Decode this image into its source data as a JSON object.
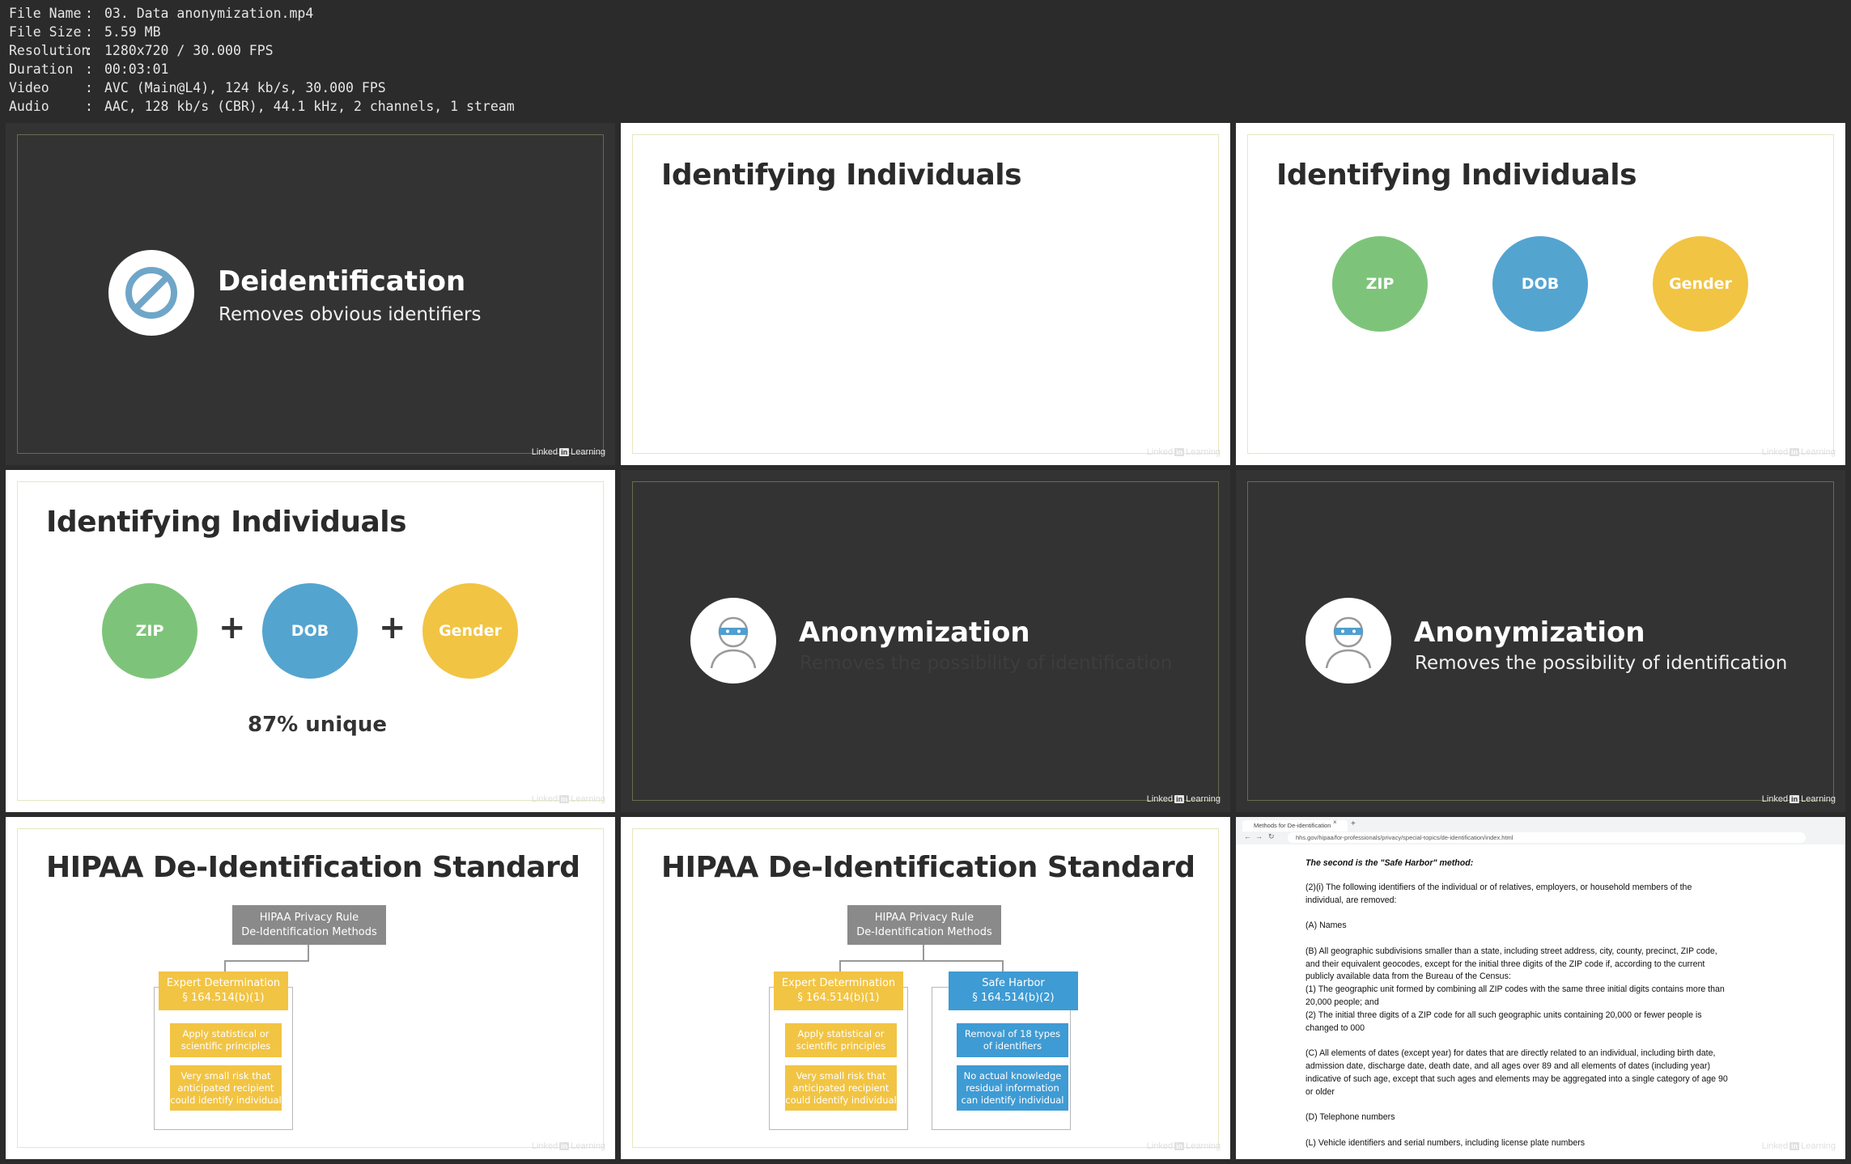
{
  "file_info": [
    {
      "key": "File Name",
      "value": "03. Data anonymization.mp4"
    },
    {
      "key": "File Size",
      "value": "5.59 MB"
    },
    {
      "key": "Resolution",
      "value": "1280x720 / 30.000 FPS"
    },
    {
      "key": "Duration",
      "value": "00:03:01"
    },
    {
      "key": "Video",
      "value": "AVC (Main@L4), 124 kb/s, 30.000 FPS"
    },
    {
      "key": "Audio",
      "value": "AAC, 128 kb/s (CBR), 44.1 kHz, 2 channels, 1 stream"
    }
  ],
  "watermark": {
    "brand": "Linked",
    "in": "in",
    "suffix": "Learning"
  },
  "frames": {
    "f1": {
      "title": "Deidentification",
      "subtitle": "Removes obvious identifiers",
      "icon": "prohibition-icon"
    },
    "f2": {
      "title": "Identifying Individuals"
    },
    "f3": {
      "title": "Identifying Individuals",
      "circles": [
        "ZIP",
        "DOB",
        "Gender"
      ]
    },
    "f4": {
      "title": "Identifying Individuals",
      "circles": [
        "ZIP",
        "DOB",
        "Gender"
      ],
      "plus": "+",
      "caption": "87% unique"
    },
    "f5": {
      "title": "Anonymization",
      "subtitle": "Removes the possibility of identification",
      "icon": "anonymous-person-icon"
    },
    "f6": {
      "title": "Anonymization",
      "subtitle": "Removes the possibility of identification",
      "icon": "anonymous-person-icon"
    },
    "f7": {
      "title": "HIPAA De-Identification Standard",
      "root": [
        "HIPAA Privacy Rule",
        "De-Identification Methods"
      ],
      "expert": [
        "Expert Determination",
        "§ 164.514(b)(1)"
      ],
      "expert_items": [
        [
          "Apply statistical or",
          "scientific principles"
        ],
        [
          "Very small risk that",
          "anticipated recipient",
          "could identify individual"
        ]
      ]
    },
    "f8": {
      "title": "HIPAA De-Identification Standard",
      "root": [
        "HIPAA Privacy Rule",
        "De-Identification Methods"
      ],
      "expert": [
        "Expert Determination",
        "§ 164.514(b)(1)"
      ],
      "expert_items": [
        [
          "Apply statistical or",
          "scientific principles"
        ],
        [
          "Very small risk that",
          "anticipated recipient",
          "could identify individual"
        ]
      ],
      "harbor": [
        "Safe Harbor",
        "§ 164.514(b)(2)"
      ],
      "harbor_items": [
        [
          "Removal of 18 types",
          "of identifiers"
        ],
        [
          "No actual knowledge",
          "residual information",
          "can identify individual"
        ]
      ]
    },
    "f9": {
      "tab_title": "Methods for De-identification",
      "tab_close": "×",
      "tab_new": "+",
      "url": "hhs.gov/hipaa/for-professionals/privacy/special-topics/de-identification/index.html",
      "lead": "The second is the \"Safe Harbor\" method:",
      "paragraphs": [
        "(2)(i) The following identifiers of the individual or of relatives, employers, or household members of the individual, are removed:",
        "(A) Names",
        "(B) All geographic subdivisions smaller than a state, including street address, city, county, precinct, ZIP code, and their equivalent geocodes, except for the initial three digits of the ZIP code if, according to the current publicly available data from the Bureau of the Census:\n(1) The geographic unit formed by combining all ZIP codes with the same three initial digits contains more than 20,000 people; and\n(2) The initial three digits of a ZIP code for all such geographic units containing 20,000 or fewer people is changed to 000",
        "(C) All elements of dates (except year) for dates that are directly related to an individual, including birth date, admission date, discharge date, death date, and all ages over 89 and all elements of dates (including year) indicative of such age, except that such ages and elements may be aggregated into a single category of age 90 or older",
        "(D) Telephone numbers",
        "(L) Vehicle identifiers and serial numbers, including license plate numbers"
      ]
    }
  }
}
